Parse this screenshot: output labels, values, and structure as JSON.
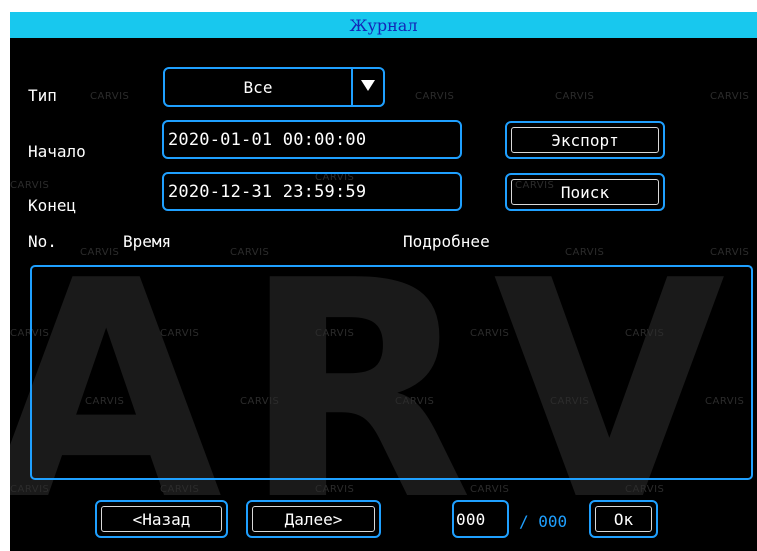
{
  "window": {
    "title": "Журнал"
  },
  "form": {
    "type_label": "Тип",
    "type_value": "Все",
    "start_label": "Начало",
    "start_value": "2020-01-01 00:00:00",
    "end_label": "Конец",
    "end_value": "2020-12-31 23:59:59"
  },
  "buttons": {
    "export": "Экспорт",
    "search": "Поиск",
    "prev": "<Назад",
    "next": "Далее>",
    "ok": "Ок"
  },
  "table": {
    "columns": [
      "No.",
      "Время",
      "Подробнее"
    ],
    "rows": []
  },
  "pager": {
    "current_page": "000",
    "separator": "/ 000"
  },
  "watermark": {
    "text": "CARVIS",
    "big_text": "ARVI"
  },
  "colors": {
    "title_bar": "#18c8ee",
    "title_text": "#1426b8",
    "accent_border": "#1fa0ff",
    "background": "#000000"
  }
}
